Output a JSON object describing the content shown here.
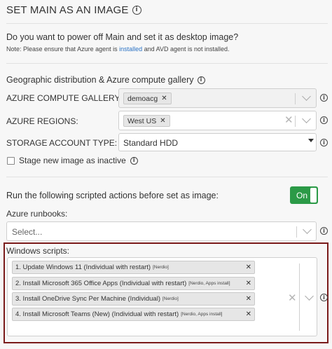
{
  "header": {
    "title": "SET MAIN AS AN IMAGE"
  },
  "power_off": {
    "question": "Do you want to power off Main and set it as desktop image?",
    "note_prefix": "Note: Please ensure that Azure agent is ",
    "note_link": "installed",
    "note_suffix": " and AVD agent is not installed."
  },
  "gallery": {
    "section_title": "Geographic distribution & Azure compute gallery",
    "compute_gallery_label": "AZURE COMPUTE GALLERY:",
    "compute_gallery_tag": "demoacg",
    "regions_label": "AZURE REGIONS:",
    "regions_tag": "West US",
    "storage_label": "STORAGE ACCOUNT TYPE:",
    "storage_value": "Standard HDD",
    "stage_label": "Stage new image as inactive"
  },
  "scripted": {
    "question": "Run the following scripted actions before set as image:",
    "toggle_label": "On",
    "runbooks_label": "Azure runbooks:",
    "runbooks_placeholder": "Select...",
    "windows_scripts_label": "Windows scripts:",
    "scripts": [
      {
        "name": "1. Update Windows 11 (Individual with restart)",
        "tags": "[Nerdio]"
      },
      {
        "name": "2. Install Microsoft 365 Office Apps (Individual with restart)",
        "tags": "[Nerdio, Apps install]"
      },
      {
        "name": "3. Install OneDrive Sync Per Machine (Individual)",
        "tags": "[Nerdio]"
      },
      {
        "name": "4. Install Microsoft Teams (New) (Individual with restart)",
        "tags": "[Nerdio, Apps install]"
      }
    ]
  },
  "icons": {
    "info": "info-circle-icon",
    "remove": "x-icon",
    "chevron": "chevron-down-icon",
    "dropdown": "caret-down-icon",
    "clear": "clear-icon"
  },
  "colors": {
    "accent_green": "#2b9a47",
    "link_blue": "#2a72c4",
    "highlight_border": "#7a1a1a"
  }
}
